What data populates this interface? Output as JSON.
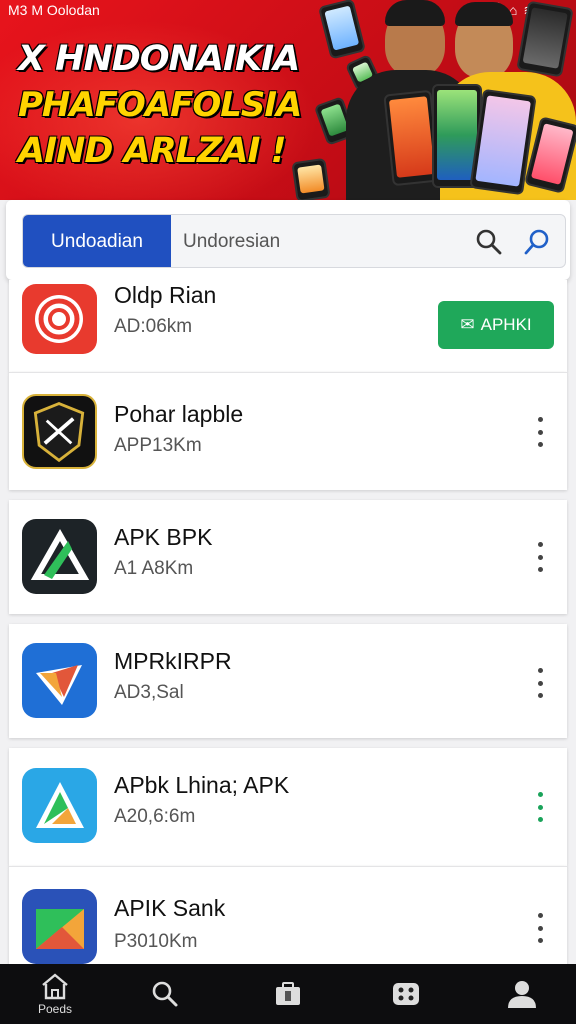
{
  "status_bar": {
    "left_text": "M3 M Oolodan"
  },
  "banner": {
    "headline": [
      "X HNDONAIKIA",
      "PHAFOAFOLSIA",
      "AIND ARLZAI !"
    ]
  },
  "search": {
    "button_label": "Undoadian",
    "placeholder": "Undoresian"
  },
  "apps": [
    {
      "name": "Oldp Rian",
      "size": "AD:06km",
      "action": "APHKI"
    },
    {
      "name": "Pohar lapble",
      "size": "APP13Km"
    },
    {
      "name": "APK BPK",
      "size": "A1 A8Km"
    },
    {
      "name": "MPRkIRPR",
      "size": "AD3,Sal"
    },
    {
      "name": "APbk Lhina; APK",
      "size": "A20,6:6m"
    },
    {
      "name": "APIK Sank",
      "size": "P3010Km"
    }
  ],
  "bottom_nav": {
    "home_label": "Poeds"
  },
  "colors": {
    "accent": "#2050c0",
    "apk_green": "#1fa85a",
    "banner_red": "#e8141c",
    "headline_yellow": "#ffd400"
  }
}
